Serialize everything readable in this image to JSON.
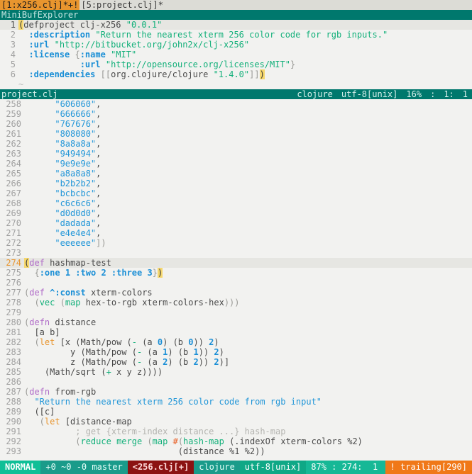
{
  "tabline": {
    "tabs": [
      {
        "label": "[1:x256.clj]*+!",
        "active": true
      },
      {
        "label": "[5:project.clj]*",
        "active": false
      }
    ]
  },
  "minibuf": {
    "title": "MiniBufExplorer"
  },
  "top_window": {
    "lines": [
      {
        "num": "1",
        "cursor": true,
        "tokens": [
          {
            "t": "(",
            "c": "s-match"
          },
          {
            "t": "defproject clj-x256 ",
            "c": "s-plain"
          },
          {
            "t": "\"0.0.1\"",
            "c": "s-str"
          }
        ]
      },
      {
        "num": "2",
        "cursor": false,
        "tokens": [
          {
            "t": "  ",
            "c": "s-plain"
          },
          {
            "t": ":description",
            "c": "s-key"
          },
          {
            "t": " ",
            "c": "s-plain"
          },
          {
            "t": "\"Return the nearest xterm 256 color code for rgb inputs.\"",
            "c": "s-str"
          }
        ]
      },
      {
        "num": "3",
        "cursor": false,
        "tokens": [
          {
            "t": "  ",
            "c": "s-plain"
          },
          {
            "t": ":url",
            "c": "s-key"
          },
          {
            "t": " ",
            "c": "s-plain"
          },
          {
            "t": "\"http://bitbucket.org/john2x/clj-x256\"",
            "c": "s-str"
          }
        ]
      },
      {
        "num": "4",
        "cursor": false,
        "tokens": [
          {
            "t": "  ",
            "c": "s-plain"
          },
          {
            "t": ":license",
            "c": "s-key"
          },
          {
            "t": " {",
            "c": "s-paren"
          },
          {
            "t": ":name",
            "c": "s-key"
          },
          {
            "t": " ",
            "c": "s-plain"
          },
          {
            "t": "\"MIT\"",
            "c": "s-str"
          }
        ]
      },
      {
        "num": "5",
        "cursor": false,
        "tokens": [
          {
            "t": "            ",
            "c": "s-plain"
          },
          {
            "t": ":url",
            "c": "s-key"
          },
          {
            "t": " ",
            "c": "s-plain"
          },
          {
            "t": "\"http://opensource.org/licenses/MIT\"",
            "c": "s-str"
          },
          {
            "t": "}",
            "c": "s-paren"
          }
        ]
      },
      {
        "num": "6",
        "cursor": false,
        "tokens": [
          {
            "t": "  ",
            "c": "s-plain"
          },
          {
            "t": ":dependencies",
            "c": "s-key"
          },
          {
            "t": " ",
            "c": "s-plain"
          },
          {
            "t": "[[",
            "c": "s-paren"
          },
          {
            "t": "org.clojure/clojure ",
            "c": "s-plain"
          },
          {
            "t": "\"1.4.0\"",
            "c": "s-str"
          },
          {
            "t": "]]",
            "c": "s-paren"
          },
          {
            "t": ")",
            "c": "s-match"
          }
        ]
      },
      {
        "num": "",
        "cursor": false,
        "tilde": true,
        "tokens": []
      }
    ],
    "statusline": {
      "filename": "project.clj",
      "filetype": "clojure",
      "encoding": "utf-8[unix]",
      "percent": "16%",
      "separator": ":",
      "line": "1:",
      "col": "1"
    }
  },
  "main_window": {
    "lines": [
      {
        "num": "258",
        "cursor": false,
        "tokens": [
          {
            "t": "      ",
            "c": "s-plain"
          },
          {
            "t": "\"606060\"",
            "c": "s-str-b"
          },
          {
            "t": ",",
            "c": "s-plain"
          }
        ]
      },
      {
        "num": "259",
        "cursor": false,
        "tokens": [
          {
            "t": "      ",
            "c": "s-plain"
          },
          {
            "t": "\"666666\"",
            "c": "s-str-b"
          },
          {
            "t": ",",
            "c": "s-plain"
          }
        ]
      },
      {
        "num": "260",
        "cursor": false,
        "tokens": [
          {
            "t": "      ",
            "c": "s-plain"
          },
          {
            "t": "\"767676\"",
            "c": "s-str-b"
          },
          {
            "t": ",",
            "c": "s-plain"
          }
        ]
      },
      {
        "num": "261",
        "cursor": false,
        "tokens": [
          {
            "t": "      ",
            "c": "s-plain"
          },
          {
            "t": "\"808080\"",
            "c": "s-str-b"
          },
          {
            "t": ",",
            "c": "s-plain"
          }
        ]
      },
      {
        "num": "262",
        "cursor": false,
        "tokens": [
          {
            "t": "      ",
            "c": "s-plain"
          },
          {
            "t": "\"8a8a8a\"",
            "c": "s-str-b"
          },
          {
            "t": ",",
            "c": "s-plain"
          }
        ]
      },
      {
        "num": "263",
        "cursor": false,
        "tokens": [
          {
            "t": "      ",
            "c": "s-plain"
          },
          {
            "t": "\"949494\"",
            "c": "s-str-b"
          },
          {
            "t": ",",
            "c": "s-plain"
          }
        ]
      },
      {
        "num": "264",
        "cursor": false,
        "tokens": [
          {
            "t": "      ",
            "c": "s-plain"
          },
          {
            "t": "\"9e9e9e\"",
            "c": "s-str-b"
          },
          {
            "t": ",",
            "c": "s-plain"
          }
        ]
      },
      {
        "num": "265",
        "cursor": false,
        "tokens": [
          {
            "t": "      ",
            "c": "s-plain"
          },
          {
            "t": "\"a8a8a8\"",
            "c": "s-str-b"
          },
          {
            "t": ",",
            "c": "s-plain"
          }
        ]
      },
      {
        "num": "266",
        "cursor": false,
        "tokens": [
          {
            "t": "      ",
            "c": "s-plain"
          },
          {
            "t": "\"b2b2b2\"",
            "c": "s-str-b"
          },
          {
            "t": ",",
            "c": "s-plain"
          }
        ]
      },
      {
        "num": "267",
        "cursor": false,
        "tokens": [
          {
            "t": "      ",
            "c": "s-plain"
          },
          {
            "t": "\"bcbcbc\"",
            "c": "s-str-b"
          },
          {
            "t": ",",
            "c": "s-plain"
          }
        ]
      },
      {
        "num": "268",
        "cursor": false,
        "tokens": [
          {
            "t": "      ",
            "c": "s-plain"
          },
          {
            "t": "\"c6c6c6\"",
            "c": "s-str-b"
          },
          {
            "t": ",",
            "c": "s-plain"
          }
        ]
      },
      {
        "num": "269",
        "cursor": false,
        "tokens": [
          {
            "t": "      ",
            "c": "s-plain"
          },
          {
            "t": "\"d0d0d0\"",
            "c": "s-str-b"
          },
          {
            "t": ",",
            "c": "s-plain"
          }
        ]
      },
      {
        "num": "270",
        "cursor": false,
        "tokens": [
          {
            "t": "      ",
            "c": "s-plain"
          },
          {
            "t": "\"dadada\"",
            "c": "s-str-b"
          },
          {
            "t": ",",
            "c": "s-plain"
          }
        ]
      },
      {
        "num": "271",
        "cursor": false,
        "tokens": [
          {
            "t": "      ",
            "c": "s-plain"
          },
          {
            "t": "\"e4e4e4\"",
            "c": "s-str-b"
          },
          {
            "t": ",",
            "c": "s-plain"
          }
        ]
      },
      {
        "num": "272",
        "cursor": false,
        "tokens": [
          {
            "t": "      ",
            "c": "s-plain"
          },
          {
            "t": "\"eeeeee\"",
            "c": "s-str-b"
          },
          {
            "t": "])",
            "c": "s-paren"
          }
        ]
      },
      {
        "num": "273",
        "cursor": false,
        "tokens": []
      },
      {
        "num": "274",
        "cursor": true,
        "tokens": [
          {
            "t": "(",
            "c": "s-match"
          },
          {
            "t": "def",
            "c": "s-kw"
          },
          {
            "t": " hashmap-test",
            "c": "s-plain"
          }
        ]
      },
      {
        "num": "275",
        "cursor": false,
        "tokens": [
          {
            "t": "  {",
            "c": "s-paren"
          },
          {
            "t": ":one",
            "c": "s-key"
          },
          {
            "t": " ",
            "c": "s-plain"
          },
          {
            "t": "1",
            "c": "s-num"
          },
          {
            "t": " ",
            "c": "s-plain"
          },
          {
            "t": ":two",
            "c": "s-key"
          },
          {
            "t": " ",
            "c": "s-plain"
          },
          {
            "t": "2",
            "c": "s-num"
          },
          {
            "t": " ",
            "c": "s-plain"
          },
          {
            "t": ":three",
            "c": "s-key"
          },
          {
            "t": " ",
            "c": "s-plain"
          },
          {
            "t": "3",
            "c": "s-num"
          },
          {
            "t": "}",
            "c": "s-paren"
          },
          {
            "t": ")",
            "c": "s-match"
          }
        ]
      },
      {
        "num": "276",
        "cursor": false,
        "tokens": []
      },
      {
        "num": "277",
        "cursor": false,
        "tokens": [
          {
            "t": "(",
            "c": "s-paren"
          },
          {
            "t": "def",
            "c": "s-kw"
          },
          {
            "t": " ",
            "c": "s-plain"
          },
          {
            "t": "^:const",
            "c": "s-key"
          },
          {
            "t": " xterm-colors",
            "c": "s-plain"
          }
        ]
      },
      {
        "num": "278",
        "cursor": false,
        "tokens": [
          {
            "t": "  (",
            "c": "s-paren"
          },
          {
            "t": "vec",
            "c": "s-fn"
          },
          {
            "t": " (",
            "c": "s-paren"
          },
          {
            "t": "map",
            "c": "s-fn"
          },
          {
            "t": " hex-to-rgb xterm-colors-hex",
            "c": "s-plain"
          },
          {
            "t": ")))",
            "c": "s-paren"
          }
        ]
      },
      {
        "num": "279",
        "cursor": false,
        "tokens": []
      },
      {
        "num": "280",
        "cursor": false,
        "tokens": [
          {
            "t": "(",
            "c": "s-paren"
          },
          {
            "t": "defn",
            "c": "s-kw"
          },
          {
            "t": " distance",
            "c": "s-plain"
          }
        ]
      },
      {
        "num": "281",
        "cursor": false,
        "tokens": [
          {
            "t": "  [a b]",
            "c": "s-plain"
          }
        ]
      },
      {
        "num": "282",
        "cursor": false,
        "tokens": [
          {
            "t": "  (",
            "c": "s-paren"
          },
          {
            "t": "let",
            "c": "s-special"
          },
          {
            "t": " [x (Math/pow (",
            "c": "s-plain"
          },
          {
            "t": "-",
            "c": "s-op"
          },
          {
            "t": " (a ",
            "c": "s-plain"
          },
          {
            "t": "0",
            "c": "s-num"
          },
          {
            "t": ") (b ",
            "c": "s-plain"
          },
          {
            "t": "0",
            "c": "s-num"
          },
          {
            "t": ")) ",
            "c": "s-plain"
          },
          {
            "t": "2",
            "c": "s-num"
          },
          {
            "t": ")",
            "c": "s-plain"
          }
        ]
      },
      {
        "num": "283",
        "cursor": false,
        "tokens": [
          {
            "t": "         y (Math/pow (",
            "c": "s-plain"
          },
          {
            "t": "-",
            "c": "s-op"
          },
          {
            "t": " (a ",
            "c": "s-plain"
          },
          {
            "t": "1",
            "c": "s-num"
          },
          {
            "t": ") (b ",
            "c": "s-plain"
          },
          {
            "t": "1",
            "c": "s-num"
          },
          {
            "t": ")) ",
            "c": "s-plain"
          },
          {
            "t": "2",
            "c": "s-num"
          },
          {
            "t": ")",
            "c": "s-plain"
          }
        ]
      },
      {
        "num": "284",
        "cursor": false,
        "tokens": [
          {
            "t": "         z (Math/pow (",
            "c": "s-plain"
          },
          {
            "t": "-",
            "c": "s-op"
          },
          {
            "t": " (a ",
            "c": "s-plain"
          },
          {
            "t": "2",
            "c": "s-num"
          },
          {
            "t": ") (b ",
            "c": "s-plain"
          },
          {
            "t": "2",
            "c": "s-num"
          },
          {
            "t": ")) ",
            "c": "s-plain"
          },
          {
            "t": "2",
            "c": "s-num"
          },
          {
            "t": ")]",
            "c": "s-plain"
          }
        ]
      },
      {
        "num": "285",
        "cursor": false,
        "tokens": [
          {
            "t": "    (Math/sqrt (",
            "c": "s-plain"
          },
          {
            "t": "+",
            "c": "s-op"
          },
          {
            "t": " x y z))))",
            "c": "s-plain"
          }
        ]
      },
      {
        "num": "286",
        "cursor": false,
        "tokens": []
      },
      {
        "num": "287",
        "cursor": false,
        "tokens": [
          {
            "t": "(",
            "c": "s-paren"
          },
          {
            "t": "defn",
            "c": "s-kw"
          },
          {
            "t": " from-rgb",
            "c": "s-plain"
          }
        ]
      },
      {
        "num": "288",
        "cursor": false,
        "tokens": [
          {
            "t": "  ",
            "c": "s-plain"
          },
          {
            "t": "\"Return the nearest xterm 256 color code from rgb input\"",
            "c": "s-str-b"
          }
        ]
      },
      {
        "num": "289",
        "cursor": false,
        "tokens": [
          {
            "t": "  ([c]",
            "c": "s-plain"
          }
        ]
      },
      {
        "num": "290",
        "cursor": false,
        "tokens": [
          {
            "t": "   (",
            "c": "s-paren"
          },
          {
            "t": "let",
            "c": "s-special"
          },
          {
            "t": " [distance-map",
            "c": "s-plain"
          }
        ]
      },
      {
        "num": "291",
        "cursor": false,
        "tokens": [
          {
            "t": "          ; get {xterm-index distance ...} hash-map",
            "c": "s-comment"
          }
        ]
      },
      {
        "num": "292",
        "cursor": false,
        "tokens": [
          {
            "t": "          (",
            "c": "s-paren"
          },
          {
            "t": "reduce",
            "c": "s-fn"
          },
          {
            "t": " ",
            "c": "s-plain"
          },
          {
            "t": "merge",
            "c": "s-fn"
          },
          {
            "t": " (",
            "c": "s-paren"
          },
          {
            "t": "map",
            "c": "s-fn"
          },
          {
            "t": " ",
            "c": "s-plain"
          },
          {
            "t": "#",
            "c": "s-anon"
          },
          {
            "t": "(",
            "c": "s-paren"
          },
          {
            "t": "hash-map",
            "c": "s-fn"
          },
          {
            "t": " (.indexOf xterm-colors %2)",
            "c": "s-plain"
          }
        ]
      },
      {
        "num": "293",
        "cursor": false,
        "tokens": [
          {
            "t": "                              (distance %1 %2))",
            "c": "s-plain"
          }
        ]
      }
    ]
  },
  "statusbar": {
    "mode": "NORMAL",
    "git": "+0 ~0 -0 master",
    "file": "<256.clj[+]",
    "filetype": "clojure",
    "encoding": "utf-8[unix]",
    "position": "87% : 274:  1",
    "warning": "! trailing[290]"
  },
  "colors": {
    "tab_active_bg": "#e8952e",
    "tab_inactive_bg": "#dcdcd6",
    "minibuf_bg": "#00786d",
    "statusline_bg": "#00786d",
    "mode_bg": "#0fbf97",
    "file_bg": "#8b1212",
    "warning_bg": "#f07818",
    "cursorline_bg": "#e6e6e2",
    "pane_bg": "#f2f2f0",
    "match_paren_bg": "#f5d76e"
  }
}
